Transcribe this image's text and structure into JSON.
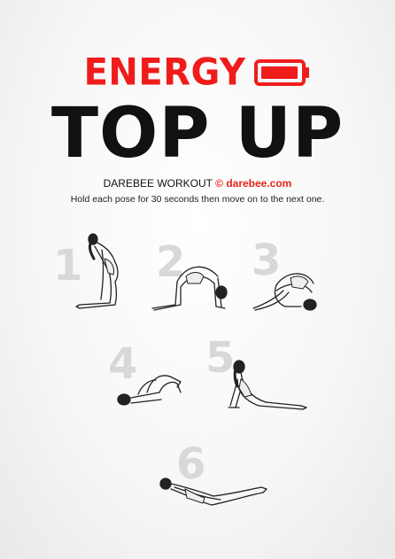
{
  "header": {
    "title_top": "ENERGY",
    "title_main": "TOP UP",
    "battery_icon": "battery-low-icon",
    "accent_color": "#f01c1c"
  },
  "credit": {
    "brand": "DAREBEE WORKOUT",
    "copyright_symbol": "©",
    "site": "darebee.com"
  },
  "instructions": "Hold each pose for 30 seconds then move on to the next one.",
  "poses": [
    {
      "number": "1",
      "icon": "camel-pose-icon"
    },
    {
      "number": "2",
      "icon": "cat-cow-pose-icon"
    },
    {
      "number": "3",
      "icon": "childs-pose-icon"
    },
    {
      "number": "4",
      "icon": "knees-to-chest-pose-icon"
    },
    {
      "number": "5",
      "icon": "cobra-pose-icon"
    },
    {
      "number": "6",
      "icon": "locust-pose-icon"
    }
  ]
}
